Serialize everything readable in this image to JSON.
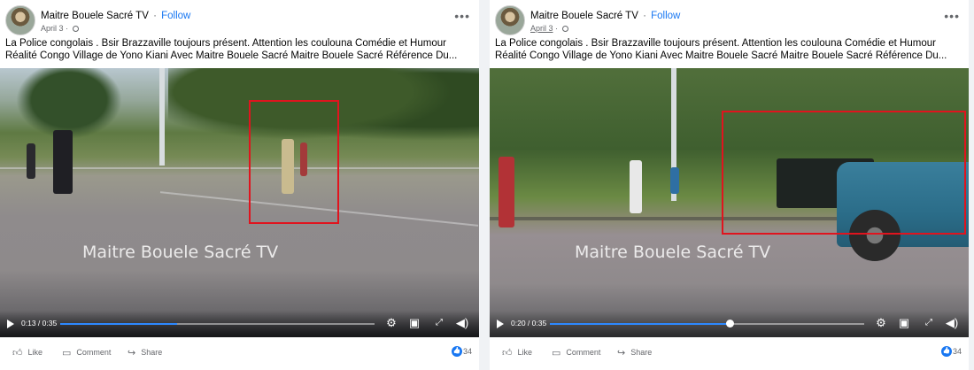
{
  "posts": [
    {
      "author": "Maitre Bouele Sacré TV",
      "dot": "·",
      "follow": "Follow",
      "date": "April 3",
      "more": "•••",
      "caption_line1": "La Police congolais . Bsir Brazzaville toujours présent. Attention les coulouna Comédie et Humour",
      "caption_line2": "Réalité Congo Village de Yono Kiani Avec Maitre Bouele Sacré Maitre Bouele Sacré Référence Du...",
      "watermark": "Maitre Bouele Sacré TV",
      "time": "0:13 / 0:35",
      "progress": 0.371,
      "like": "Like",
      "comment": "Comment",
      "share": "Share",
      "reaction_count": "34"
    },
    {
      "author": "Maitre Bouele Sacré TV",
      "dot": "·",
      "follow": "Follow",
      "date": "April 3",
      "more": "•••",
      "caption_line1": "La Police congolais . Bsir Brazzaville toujours présent. Attention les coulouna Comédie et Humour",
      "caption_line2": "Réalité Congo Village de Yono Kiani Avec Maitre Bouele Sacré Maitre Bouele Sacré Référence Du...",
      "watermark": "Maitre Bouele Sacré TV",
      "time": "0:20 / 0:35",
      "progress": 0.571,
      "like": "Like",
      "comment": "Comment",
      "share": "Share",
      "reaction_count": "34"
    }
  ],
  "icons": {
    "play": "play-icon",
    "settings": "gear-icon",
    "pip": "picture-in-picture-icon",
    "fullscreen": "fullscreen-icon",
    "volume": "volume-icon",
    "like": "thumbs-up-icon",
    "comment": "comment-icon",
    "share": "share-icon",
    "globe": "globe-icon"
  },
  "colors": {
    "accent": "#1877f2",
    "progress": "#2d88ff",
    "highlight_box": "#e0141e"
  }
}
